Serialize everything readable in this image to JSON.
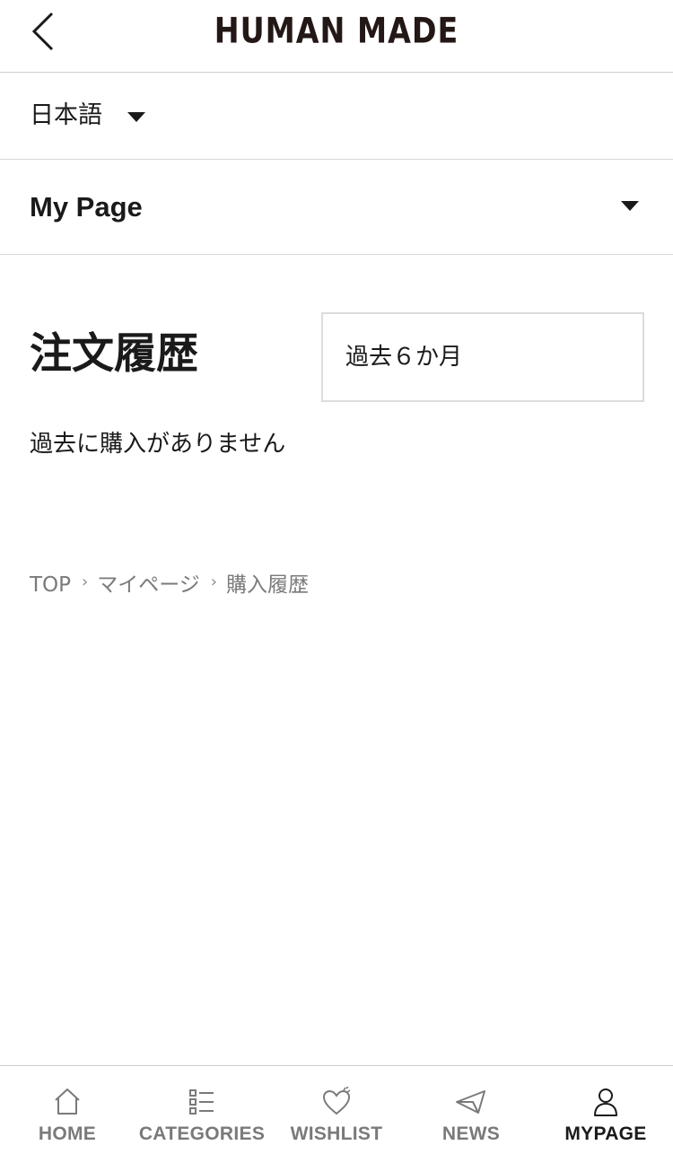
{
  "header": {
    "logo_text": "HUMAN MADE",
    "back_icon": "chevron-left-icon"
  },
  "language": {
    "selected": "日本語",
    "caret_icon": "caret-down-icon"
  },
  "section_menu": {
    "label": "My Page",
    "caret_icon": "caret-down-icon"
  },
  "orders": {
    "title": "注文履歴",
    "period_selected": "過去６か月",
    "empty_message": "過去に購入がありません"
  },
  "breadcrumb": {
    "items": [
      "TOP",
      "マイページ",
      "購入履歴"
    ],
    "separator": "›"
  },
  "tabbar": {
    "active": "MYPAGE",
    "active_color": "#1a1a1a",
    "inactive_color": "#7a7a7a",
    "tabs": [
      {
        "label": "HOME",
        "icon": "home-icon"
      },
      {
        "label": "CATEGORIES",
        "icon": "list-icon"
      },
      {
        "label": "WISHLIST",
        "icon": "heart-icon"
      },
      {
        "label": "NEWS",
        "icon": "paper-plane-icon"
      },
      {
        "label": "MYPAGE",
        "icon": "user-icon"
      }
    ]
  }
}
